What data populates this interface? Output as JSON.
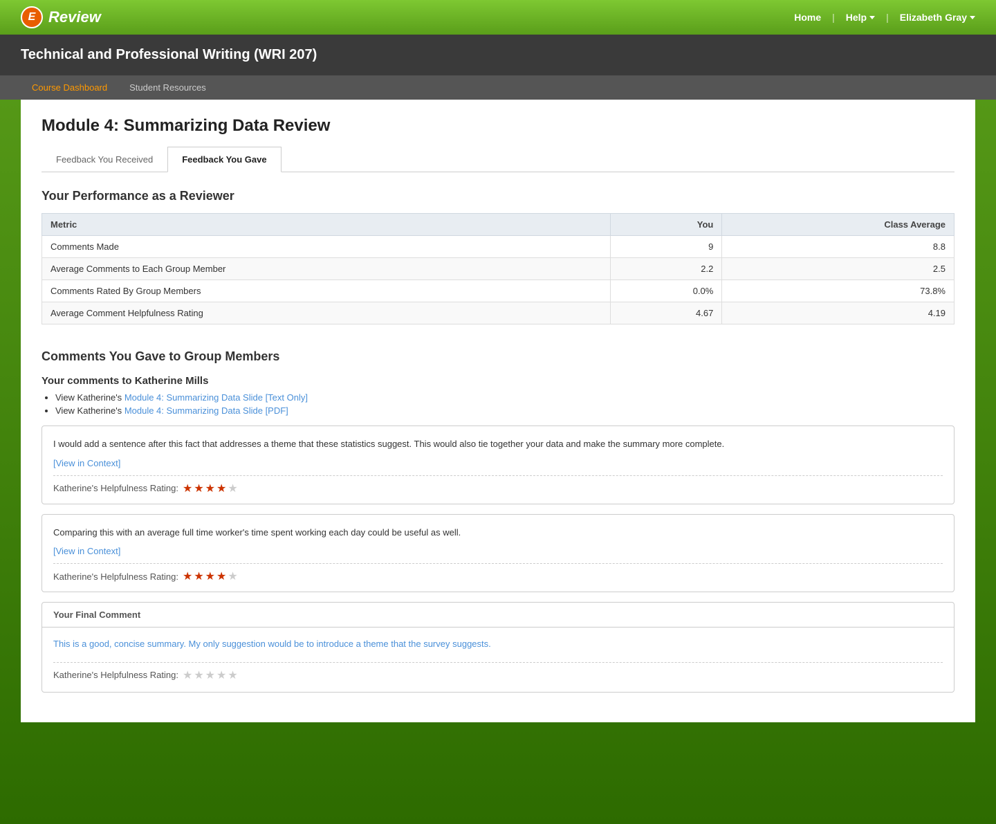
{
  "topnav": {
    "home_label": "Home",
    "help_label": "Help",
    "user_label": "Elizabeth Gray",
    "logo_text": "Review"
  },
  "course": {
    "title": "Technical and Professional Writing (WRI 207)",
    "subnav": {
      "items": [
        {
          "label": "Course Dashboard",
          "active": true
        },
        {
          "label": "Student Resources",
          "active": false
        }
      ]
    }
  },
  "module": {
    "title": "Module 4: Summarizing Data Review",
    "tabs": [
      {
        "label": "Feedback You Received",
        "active": false
      },
      {
        "label": "Feedback You Gave",
        "active": true
      }
    ]
  },
  "performance": {
    "section_title": "Your Performance as a Reviewer",
    "columns": [
      "Metric",
      "You",
      "Class Average"
    ],
    "rows": [
      {
        "metric": "Comments Made",
        "you": "9",
        "class_avg": "8.8"
      },
      {
        "metric": "Average Comments to Each Group Member",
        "you": "2.2",
        "class_avg": "2.5"
      },
      {
        "metric": "Comments Rated By Group Members",
        "you": "0.0%",
        "class_avg": "73.8%"
      },
      {
        "metric": "Average Comment Helpfulness Rating",
        "you": "4.67",
        "class_avg": "4.19"
      }
    ]
  },
  "comments_section": {
    "title": "Comments You Gave to Group Members",
    "recipient": {
      "name": "Katherine Mills",
      "header": "Your comments to Katherine Mills",
      "links": [
        {
          "text": "Module 4: Summarizing Data Slide [Text Only]",
          "prefix": "View Katherine's"
        },
        {
          "text": "Module 4: Summarizing Data Slide [PDF]",
          "prefix": "View Katherine's"
        }
      ]
    },
    "comments": [
      {
        "text": "I would add a sentence after this fact that addresses a theme that these statistics suggest. This would also tie together your data and make the summary more complete.",
        "view_context": "[View in Context]",
        "rating_label": "Katherine's Helpfulness Rating:",
        "stars_filled": 4,
        "stars_total": 5
      },
      {
        "text": "Comparing this with an average full time worker's time spent working each day could be useful as well.",
        "view_context": "[View in Context]",
        "rating_label": "Katherine's Helpfulness Rating:",
        "stars_filled": 4,
        "stars_total": 5
      }
    ],
    "final_comment": {
      "header": "Your Final Comment",
      "text": "This is a good, concise summary. My only suggestion would be to introduce a theme that the survey suggests.",
      "rating_label": "Katherine's Helpfulness Rating:",
      "stars_filled": 0,
      "stars_total": 5
    }
  }
}
